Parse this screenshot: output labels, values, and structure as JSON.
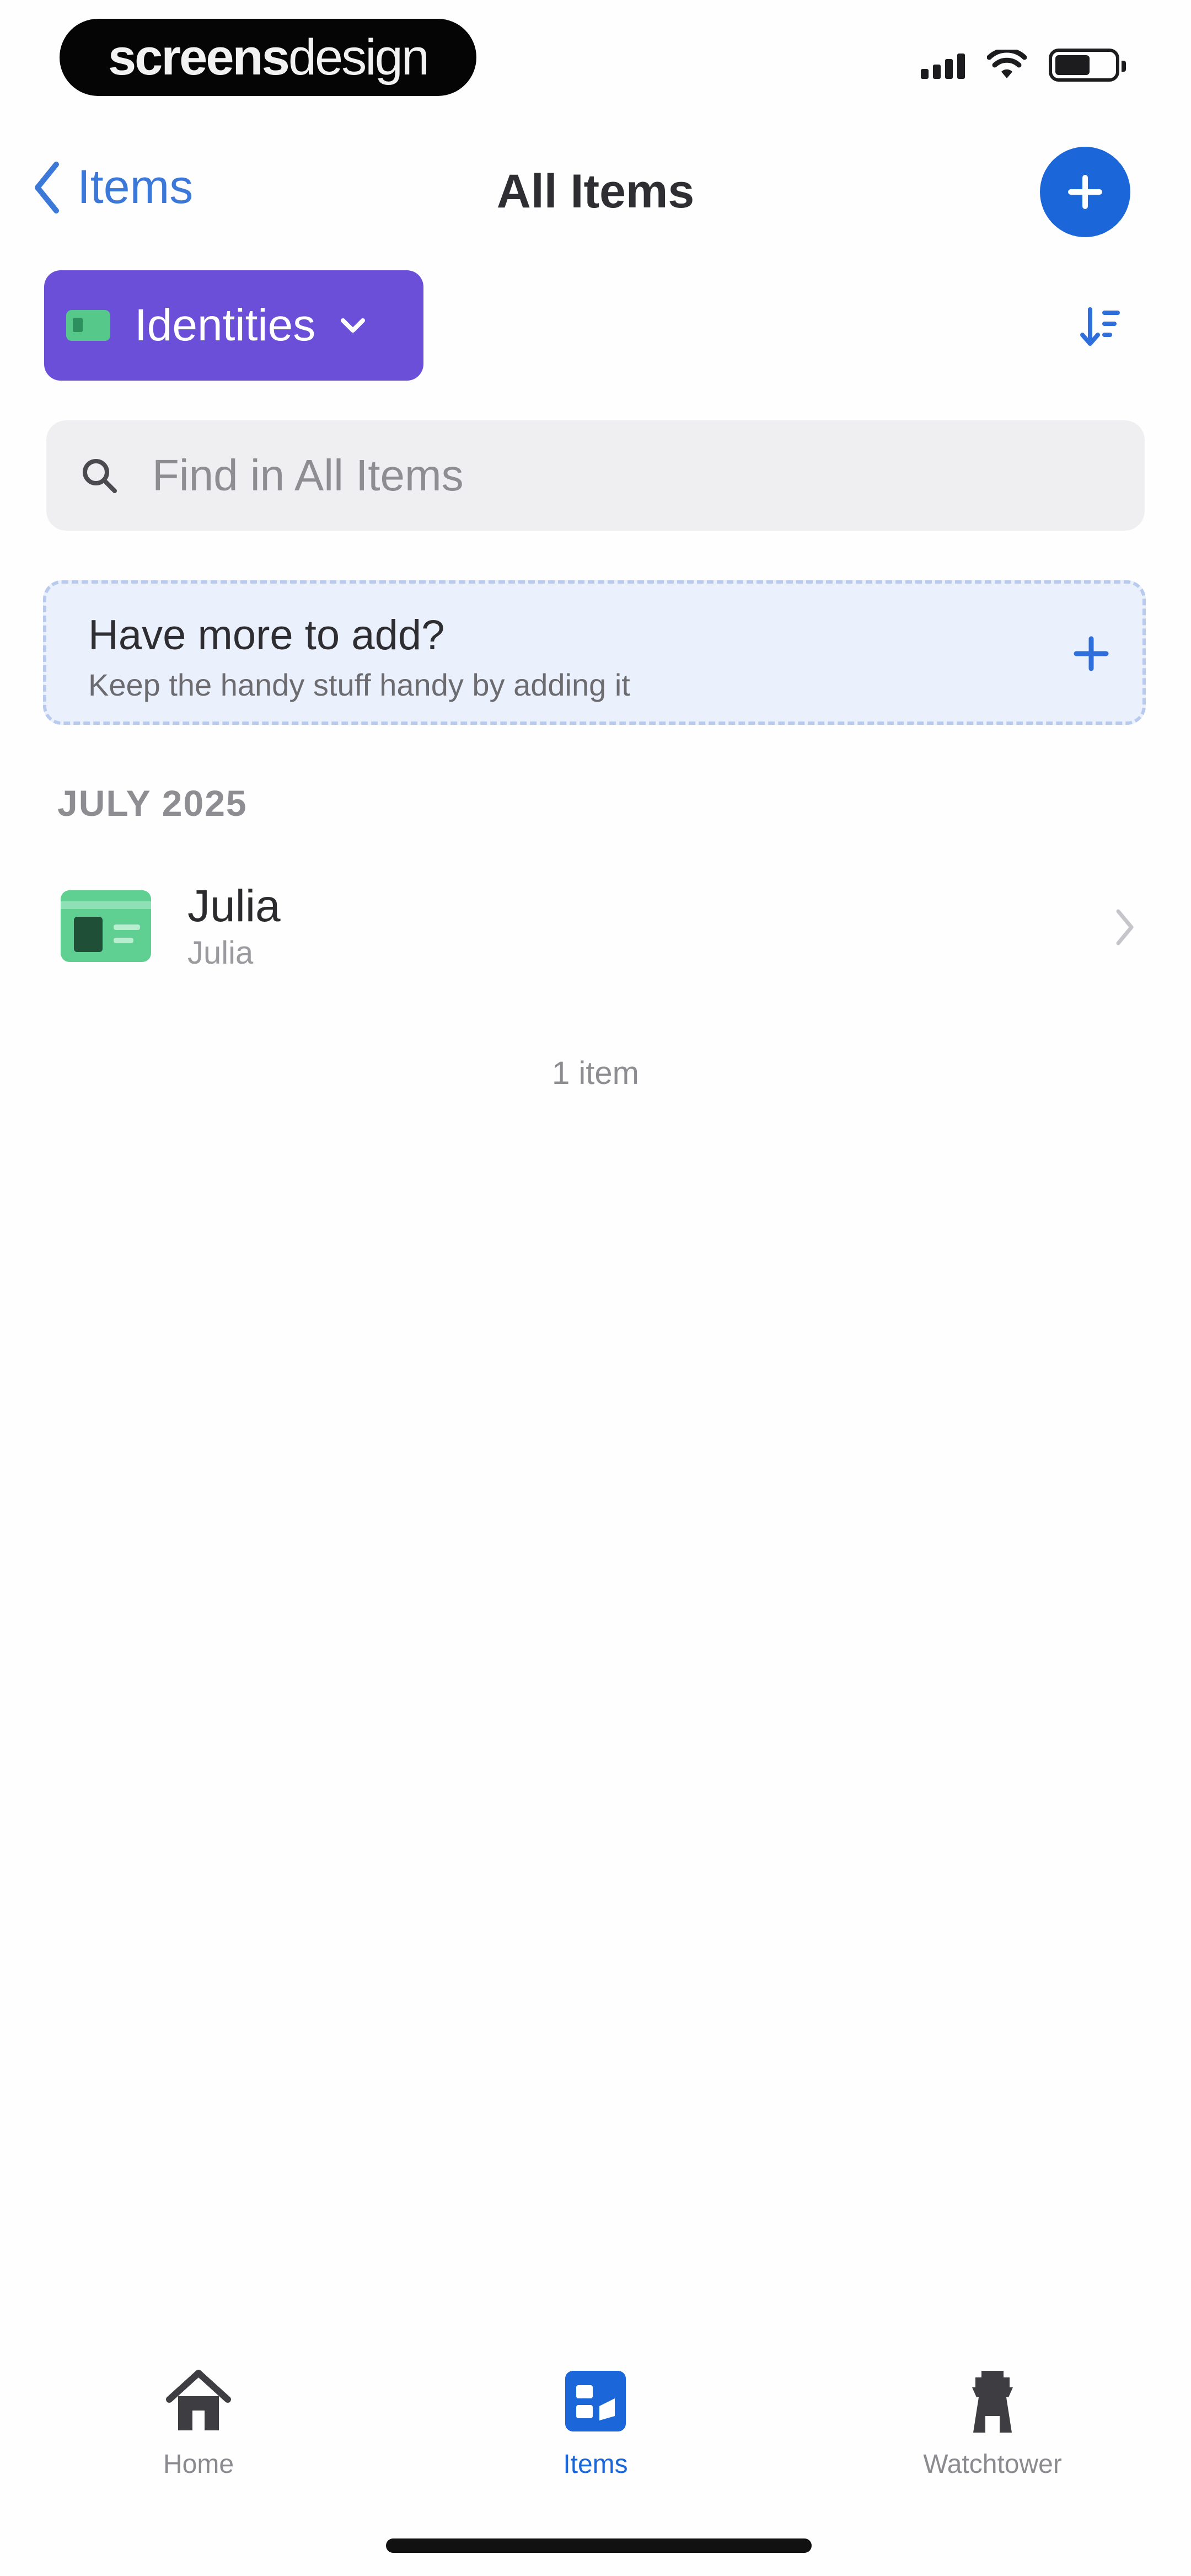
{
  "status_bar": {
    "brand_bold": "screens",
    "brand_light": "design"
  },
  "nav": {
    "back_label": "Items",
    "title": "All Items",
    "add_icon": "plus-icon"
  },
  "filter": {
    "label": "Identities",
    "icon": "identity-card-icon",
    "chip_color": "#6c4fd8"
  },
  "search": {
    "placeholder": "Find in All Items"
  },
  "promo": {
    "title": "Have more to add?",
    "subtitle": "Keep the handy stuff handy by adding it"
  },
  "section": {
    "header": "JULY 2025"
  },
  "items": [
    {
      "title": "Julia",
      "subtitle": "Julia",
      "icon": "identity-card-icon"
    }
  ],
  "footer": {
    "count": "1 item"
  },
  "tabs": [
    {
      "label": "Home",
      "icon": "home-icon",
      "active": false
    },
    {
      "label": "Items",
      "icon": "items-icon",
      "active": true
    },
    {
      "label": "Watchtower",
      "icon": "watchtower-icon",
      "active": false
    }
  ],
  "colors": {
    "accent": "#1b67d9",
    "identity_green": "#5fcf92",
    "promo_bg": "#eaf0fc"
  }
}
